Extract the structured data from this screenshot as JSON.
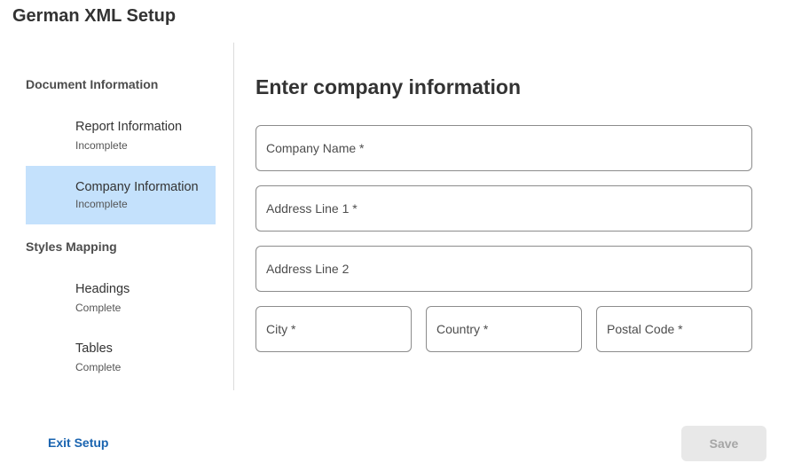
{
  "app": {
    "title": "German XML Setup"
  },
  "sidebar": {
    "sections": [
      {
        "label": "Document Information",
        "items": [
          {
            "label": "Report Information",
            "status": "Incomplete"
          },
          {
            "label": "Company Information",
            "status": "Incomplete",
            "active": true
          }
        ]
      },
      {
        "label": "Styles Mapping",
        "items": [
          {
            "label": "Headings",
            "status": "Complete"
          },
          {
            "label": "Tables",
            "status": "Complete"
          }
        ]
      }
    ]
  },
  "main": {
    "heading": "Enter company information",
    "fields": {
      "company_name": {
        "placeholder": "Company Name *",
        "value": ""
      },
      "address_line_1": {
        "placeholder": "Address Line 1 *",
        "value": ""
      },
      "address_line_2": {
        "placeholder": "Address Line 2",
        "value": ""
      },
      "city": {
        "placeholder": "City *",
        "value": ""
      },
      "country": {
        "placeholder": "Country *",
        "value": ""
      },
      "postal_code": {
        "placeholder": "Postal Code *",
        "value": ""
      }
    }
  },
  "footer": {
    "exit_label": "Exit Setup",
    "save_label": "Save"
  },
  "colors": {
    "active_item_bg": "#c4e1fc",
    "link": "#1a64b0",
    "disabled_button_bg": "#e8e8e8",
    "disabled_button_text": "#a6a6a6"
  }
}
